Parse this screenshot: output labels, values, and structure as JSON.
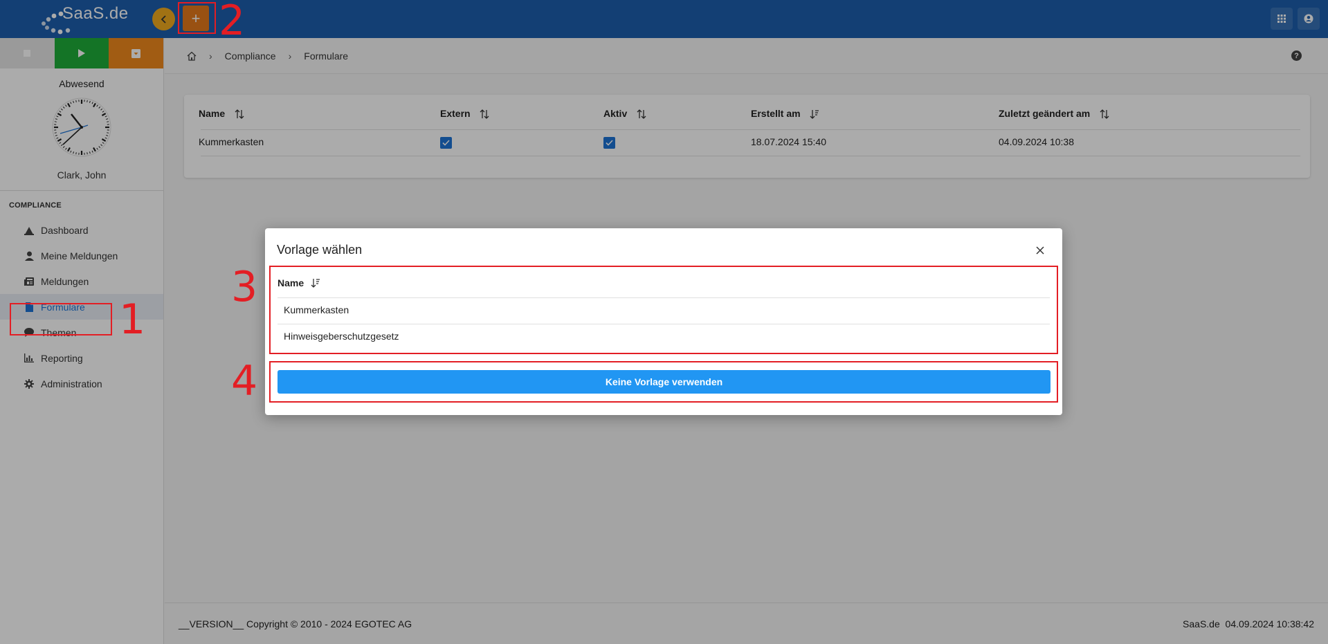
{
  "topbar": {
    "logo_text": "SaaS.de",
    "add_label": "+"
  },
  "sidebar": {
    "status_label": "Abwesend",
    "user_name": "Clark, John",
    "section_title": "COMPLIANCE",
    "items": [
      {
        "label": "Dashboard"
      },
      {
        "label": "Meine Meldungen"
      },
      {
        "label": "Meldungen"
      },
      {
        "label": "Formulare"
      },
      {
        "label": "Themen"
      },
      {
        "label": "Reporting"
      },
      {
        "label": "Administration"
      }
    ],
    "active_item": "Formulare"
  },
  "breadcrumb": {
    "items": [
      "Compliance",
      "Formulare"
    ]
  },
  "table": {
    "columns": [
      "Name",
      "Extern",
      "Aktiv",
      "Erstellt am",
      "Zuletzt geändert am"
    ],
    "rows": [
      {
        "name": "Kummerkasten",
        "extern": true,
        "aktiv": true,
        "erstellt": "18.07.2024 15:40",
        "geaendert": "04.09.2024 10:38"
      }
    ]
  },
  "footer": {
    "left": "__VERSION__ Copyright © 2010 - 2024 EGOTEC AG",
    "brand": "SaaS.de",
    "datetime": "04.09.2024 10:38:42"
  },
  "dialog": {
    "title": "Vorlage wählen",
    "column": "Name",
    "rows": [
      "Kummerkasten",
      "Hinweisgeberschutzgesetz"
    ],
    "button": "Keine Vorlage verwenden"
  },
  "annotations": [
    "1",
    "2",
    "3",
    "4"
  ],
  "colors": {
    "topbar": "#1d5fae",
    "accent_orange": "#e57a1c",
    "accent_yellow": "#f0ab1e",
    "primary_blue": "#2196f3",
    "annotation_red": "#e31e24"
  }
}
